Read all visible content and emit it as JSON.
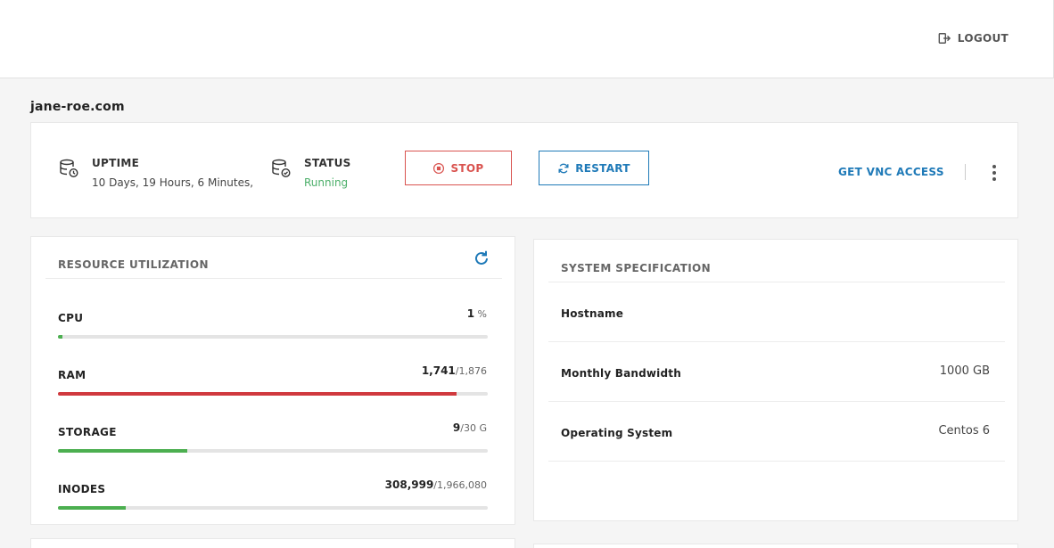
{
  "header": {
    "logout_label": "LOGOUT",
    "logout_icon": "logout-icon"
  },
  "domain": "jane-roe.com",
  "status_card": {
    "uptime_label": "UPTIME",
    "uptime_value": "10 Days, 19 Hours, 6 Minutes,",
    "status_label": "STATUS",
    "status_value": "Running",
    "stop_label": "STOP",
    "restart_label": "RESTART",
    "vnc_label": "GET VNC ACCESS"
  },
  "resource": {
    "title": "RESOURCE UTILIZATION",
    "metrics": [
      {
        "name": "CPU",
        "used": "1",
        "total": "",
        "unit": " %",
        "fraction": 0.01,
        "color": "#4caf50"
      },
      {
        "name": "RAM",
        "used": "1,741",
        "total": "/1,876",
        "unit": "",
        "fraction": 0.928,
        "color": "#d0393e"
      },
      {
        "name": "STORAGE",
        "used": "9",
        "total": "/30 G",
        "unit": "",
        "fraction": 0.3,
        "color": "#4caf50"
      },
      {
        "name": "INODES",
        "used": "308,999",
        "total": "/1,966,080",
        "unit": "",
        "fraction": 0.157,
        "color": "#4caf50"
      }
    ]
  },
  "spec": {
    "title": "SYSTEM SPECIFICATION",
    "rows": [
      {
        "label": "Hostname",
        "value": ""
      },
      {
        "label": "Monthly Bandwidth",
        "value": "1000 GB"
      },
      {
        "label": "Operating System",
        "value": "Centos 6"
      }
    ]
  },
  "colors": {
    "accent": "#1f7ab8",
    "danger": "#d9534f",
    "success": "#4caf6a"
  }
}
